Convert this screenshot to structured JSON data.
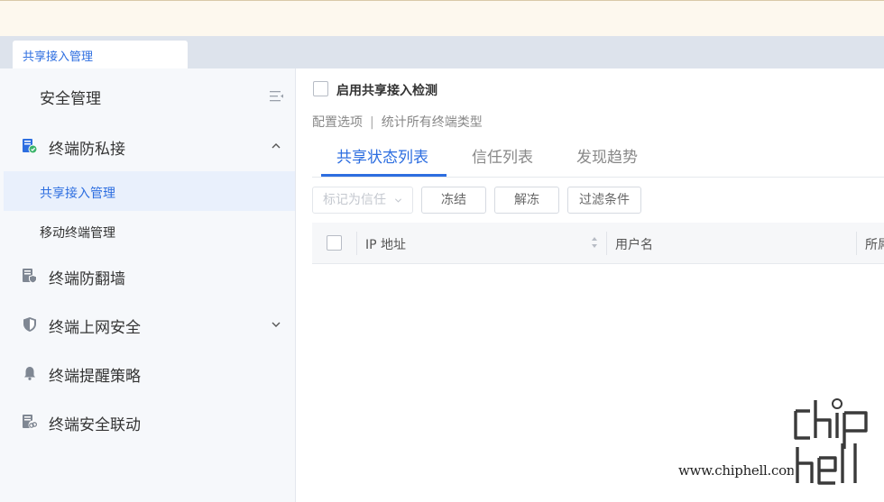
{
  "page_tab": {
    "label": "共享接入管理"
  },
  "sidebar": {
    "title": "安全管理",
    "groups": [
      {
        "label": "终端防私接",
        "icon": "terminal-check-icon",
        "expanded": true,
        "items": [
          {
            "label": "共享接入管理",
            "active": true
          },
          {
            "label": "移动终端管理",
            "active": false
          }
        ]
      },
      {
        "label": "终端防翻墙",
        "icon": "terminal-shield-icon"
      },
      {
        "label": "终端上网安全",
        "icon": "shield-icon",
        "expandable": true
      },
      {
        "label": "终端提醒策略",
        "icon": "bell-icon"
      },
      {
        "label": "终端安全联动",
        "icon": "terminal-link-icon"
      }
    ]
  },
  "content": {
    "enable_label": "启用共享接入检测",
    "enable_checked": false,
    "config_label": "配置选项",
    "config_separator": "|",
    "config_value": "统计所有终端类型",
    "tabs": [
      {
        "label": "共享状态列表",
        "active": true
      },
      {
        "label": "信任列表",
        "active": false
      },
      {
        "label": "发现趋势",
        "active": false
      }
    ],
    "toolbar": {
      "mark_trust_label": "标记为信任",
      "freeze_label": "冻结",
      "unfreeze_label": "解冻",
      "filter_label": "过滤条件"
    },
    "table": {
      "columns": [
        "IP 地址",
        "用户名",
        "所屌"
      ]
    }
  },
  "watermark": {
    "text": "www.chiphell.com",
    "logo": "chiphell-logo"
  },
  "colors": {
    "accent": "#2d6ee0",
    "banner_bg": "#fdf8ee",
    "sidebar_bg": "#f6f8fb",
    "active_item_bg": "#e9f0fc"
  }
}
